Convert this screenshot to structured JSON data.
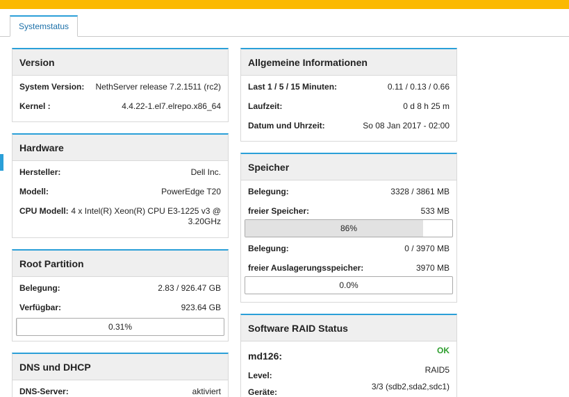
{
  "tab": {
    "label": "Systemstatus"
  },
  "version": {
    "title": "Version",
    "rows": [
      {
        "k": "System Version:",
        "v": "NethServer release 7.2.1511 (rc2)"
      },
      {
        "k": "Kernel :",
        "v": "4.4.22-1.el7.elrepo.x86_64"
      }
    ]
  },
  "hardware": {
    "title": "Hardware",
    "rows": [
      {
        "k": "Hersteller:",
        "v": "Dell Inc."
      },
      {
        "k": "Modell:",
        "v": "PowerEdge T20"
      },
      {
        "k": "CPU Modell:",
        "v": "4 x Intel(R) Xeon(R) CPU E3-1225 v3 @ 3.20GHz"
      }
    ]
  },
  "root": {
    "title": "Root Partition",
    "rows": [
      {
        "k": "Belegung:",
        "v": "2.83 / 926.47 GB"
      },
      {
        "k": "Verfügbar:",
        "v": "923.64 GB"
      }
    ],
    "usage_label": "0.31%",
    "usage_fraction": 0.0031
  },
  "dns": {
    "title": "DNS und DHCP",
    "rows": [
      {
        "k": "DNS-Server:",
        "v": "aktiviert"
      }
    ]
  },
  "general": {
    "title": "Allgemeine Informationen",
    "load_key_prefix": "Last ",
    "load_key_nums": "1 / 5 / 15",
    "load_key_suffix": " Minuten:",
    "load_value": "0.11 / 0.13 / 0.66",
    "rows": [
      {
        "k": "Laufzeit:",
        "v": "0 d 8 h 25 m"
      },
      {
        "k": "Datum und Uhrzeit:",
        "v": "So 08 Jan 2017 - 02:00"
      }
    ]
  },
  "memory": {
    "title": "Speicher",
    "ram_rows": [
      {
        "k": "Belegung:",
        "v": "3328 / 3861 MB"
      },
      {
        "k": "freier Speicher:",
        "v": "533 MB"
      }
    ],
    "ram_label": "86%",
    "ram_fraction": 0.86,
    "swap_rows": [
      {
        "k": "Belegung:",
        "v": "0 / 3970 MB"
      },
      {
        "k": "freier Auslagerungsspeicher:",
        "v": "3970 MB"
      }
    ],
    "swap_label": "0.0%",
    "swap_fraction": 0.0
  },
  "raid": {
    "title": "Software RAID Status",
    "device": "md126:",
    "status": "OK",
    "rows": [
      {
        "k": "Level:",
        "v": "RAID5"
      },
      {
        "k": "Geräte:",
        "v": "3/3 (sdb2,sda2,sdc1)"
      }
    ]
  },
  "colors": {
    "accent": "#2a9fd8",
    "topbar": "#fbb900",
    "ok": "#2e9e2e"
  }
}
